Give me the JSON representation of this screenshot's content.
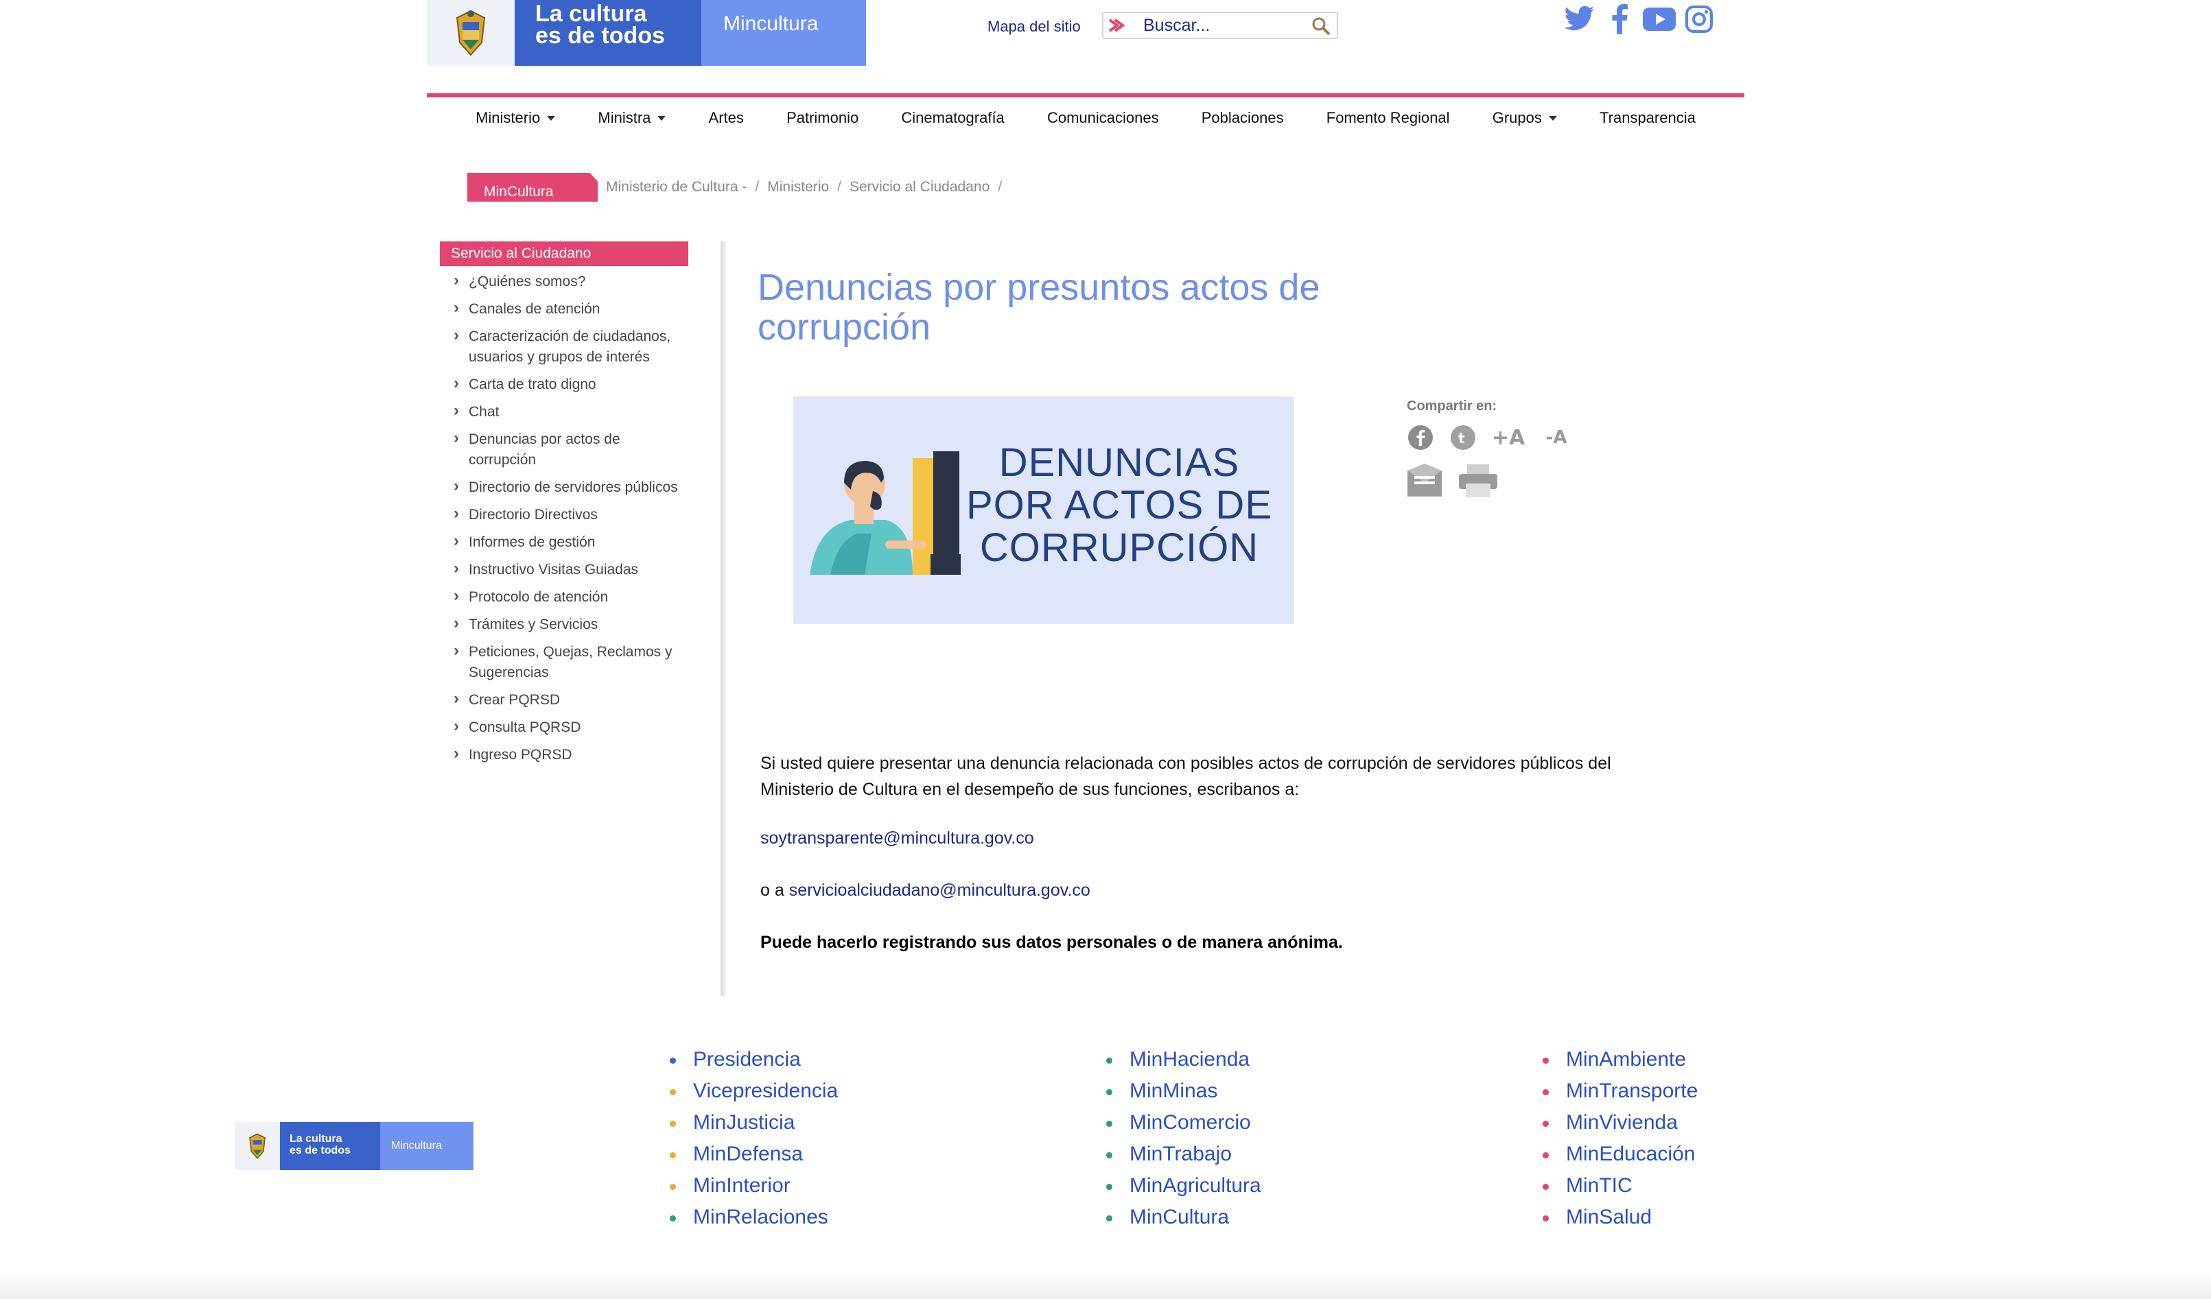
{
  "header": {
    "logo_line1": "La cultura",
    "logo_line2": "es de todos",
    "logo_brand": "Mincultura",
    "sitemap_label": "Mapa del sitio",
    "search_placeholder": "Buscar..."
  },
  "nav": {
    "items": [
      {
        "label": "Ministerio",
        "dropdown": true
      },
      {
        "label": "Ministra",
        "dropdown": true
      },
      {
        "label": "Artes",
        "dropdown": false
      },
      {
        "label": "Patrimonio",
        "dropdown": false
      },
      {
        "label": "Cinematografía",
        "dropdown": false
      },
      {
        "label": "Comunicaciones",
        "dropdown": false
      },
      {
        "label": "Poblaciones",
        "dropdown": false
      },
      {
        "label": "Fomento Regional",
        "dropdown": false
      },
      {
        "label": "Grupos",
        "dropdown": true
      },
      {
        "label": "Transparencia",
        "dropdown": false
      }
    ]
  },
  "breadcrumb": {
    "home": "MinCultura",
    "items": [
      "Ministerio de Cultura -",
      "Ministerio",
      "Servicio al Ciudadano"
    ],
    "separator": "/"
  },
  "sidebar": {
    "title": "Servicio al Ciudadano",
    "items": [
      "¿Quiénes somos?",
      "Canales de atención",
      "Caracterización de ciudadanos, usuarios y grupos de interés",
      "Carta de trato digno",
      "Chat",
      "Denuncias por actos de corrupción",
      "Directorio de servidores públicos",
      "Directorio Directivos",
      "Informes de gestión",
      "Instructivo Visitas Guiadas",
      "Protocolo de atención",
      "Trámites y Servicios",
      "Peticiones, Quejas, Reclamos y Sugerencias",
      "Crear PQRSD",
      "Consulta PQRSD",
      "Ingreso PQRSD"
    ]
  },
  "main": {
    "title": " Denuncias por presuntos actos de corrupción",
    "banner_text": "DENUNCIAS POR ACTOS DE CORRUPCIÓN",
    "share_label": "Compartir en:",
    "share_font_increase": "+A",
    "share_font_decrease": "-A",
    "paragraph1": "Si usted quiere presentar una denuncia relacionada con posibles actos de corrupción de servidores públicos del Ministerio de Cultura en el desempeño de sus funciones, escribanos a:",
    "email1": "soytransparente@mincultura.gov.co",
    "paragraph2_prefix": "o a ",
    "email2": "servicioalciudadano@mincultura.gov.co",
    "paragraph3": "Puede hacerlo registrando sus datos personales o de manera anónima."
  },
  "footer": {
    "logo_line1": "La cultura",
    "logo_line2": "es de todos",
    "logo_brand": "Mincultura",
    "col1": [
      {
        "label": "Presidencia",
        "color": "#3a63c9"
      },
      {
        "label": "Vicepresidencia",
        "color": "#f0a830"
      },
      {
        "label": "MinJusticia",
        "color": "#f0a830"
      },
      {
        "label": "MinDefensa",
        "color": "#f0a830"
      },
      {
        "label": "MinInterior",
        "color": "#f0a830"
      },
      {
        "label": "MinRelaciones",
        "color": "#2e9e6e"
      }
    ],
    "col2": [
      {
        "label": "MinHacienda",
        "color": "#2e9e6e"
      },
      {
        "label": "MinMinas",
        "color": "#2e9e6e"
      },
      {
        "label": "MinComercio",
        "color": "#2e9e6e"
      },
      {
        "label": "MinTrabajo",
        "color": "#2e9e6e"
      },
      {
        "label": "MinAgricultura",
        "color": "#2e9e6e"
      },
      {
        "label": "MinCultura",
        "color": "#2e9e6e"
      }
    ],
    "col3": [
      {
        "label": "MinAmbiente",
        "color": "#e2456f"
      },
      {
        "label": "MinTransporte",
        "color": "#e2456f"
      },
      {
        "label": "MinVivienda",
        "color": "#e2456f"
      },
      {
        "label": "MinEducación",
        "color": "#e2456f"
      },
      {
        "label": "MinTIC",
        "color": "#e2456f"
      },
      {
        "label": "MinSalud",
        "color": "#e2456f"
      }
    ]
  },
  "colors": {
    "accent": "#e2456f",
    "brand_blue": "#3a63c9",
    "brand_light_blue": "#6f93ee",
    "title_blue": "#6d8fe6",
    "link_blue": "#1c2a8a"
  }
}
